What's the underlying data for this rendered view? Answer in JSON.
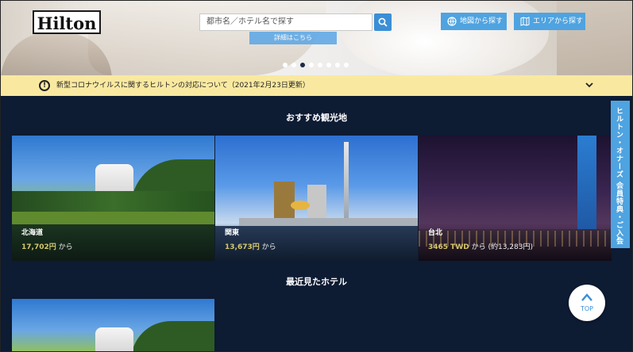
{
  "header": {
    "logo_text": "Hilton",
    "search_placeholder": "都市名／ホテル名で探す",
    "map_button": "地図から探す",
    "area_button": "エリアから探す",
    "detail_button": "詳細はこちら",
    "carousel": {
      "total": 8,
      "active_index": 2
    }
  },
  "notice": {
    "text": "新型コロナウイルスに関するヒルトンの対応について（2021年2月23日更新）"
  },
  "recommended": {
    "title": "おすすめ観光地",
    "cards": [
      {
        "name": "北海道",
        "price": "17,702円",
        "suffix": " から",
        "extra": ""
      },
      {
        "name": "関東",
        "price": "13,673円",
        "suffix": " から",
        "extra": ""
      },
      {
        "name": "台北",
        "price": "3465 TWD",
        "suffix": " から",
        "extra": " (約13,283円)"
      }
    ]
  },
  "recent": {
    "title": "最近見たホテル"
  },
  "side_tab": {
    "text": "ヒルトン・オナーズ 会員特典・ご入会"
  },
  "top_button": {
    "text": "TOP"
  },
  "colors": {
    "accent": "#4fa3e0",
    "navy": "#0d1b33",
    "notice_bg": "#f9e9a0",
    "price": "#d6c86b"
  }
}
